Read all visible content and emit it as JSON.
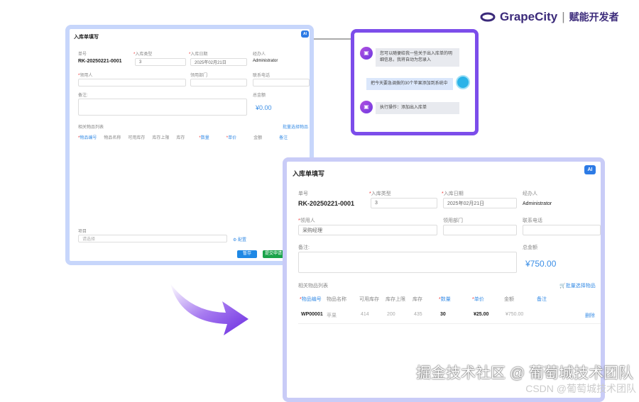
{
  "logo": {
    "brand": "GrapeCity",
    "slogan": "赋能开发者"
  },
  "form_before": {
    "title": "入库单填写",
    "ai": "AI",
    "order_no_label": "单号",
    "order_no": "RK-20250221-0001",
    "type_label": "入库类型",
    "type_value": "3",
    "date_label": "入库日期",
    "date_value": "2025年02月21日",
    "handler_label": "经办人",
    "handler": "Administrator",
    "recipient_label": "领用人",
    "dept_label": "领用部门",
    "phone_label": "联系电话",
    "remark_label": "备注:",
    "total_label": "总金额",
    "total": "¥0.00",
    "list_label": "相关物品列表",
    "batch_select": "批量选择物品",
    "columns": [
      "物品编号",
      "物品名称",
      "可用库存",
      "库存上限",
      "库存",
      "数量",
      "单价",
      "金额",
      "备注"
    ],
    "project_label": "项目",
    "project_placeholder": "请选择",
    "config": "配置",
    "save": "暂存",
    "submit": "提交申请"
  },
  "chat": {
    "messages": [
      {
        "role": "bot",
        "text": "您可以随便给我一些关于出入库单的明细信息，我将自动为您录入"
      },
      {
        "role": "user",
        "text": "把今天要急调拨的30个苹果添加到系统中"
      },
      {
        "role": "bot",
        "text": "执行操作：添加出入库单"
      }
    ]
  },
  "form_after": {
    "title": "入库单填写",
    "ai": "AI",
    "order_no_label": "单号",
    "order_no": "RK-20250221-0001",
    "type_label": "入库类型",
    "type_value": "3",
    "date_label": "入库日期",
    "date_value": "2025年02月21日",
    "handler_label": "经办人",
    "handler": "Administrator",
    "recipient_label": "领用人",
    "recipient": "采购经理",
    "dept_label": "领用部门",
    "phone_label": "联系电话",
    "remark_label": "备注:",
    "total_label": "总金额",
    "total": "¥750.00",
    "list_label": "相关物品列表",
    "batch_select": "批量选择物品",
    "columns": [
      "物品编号",
      "物品名称",
      "可用库存",
      "库存上限",
      "库存",
      "数量",
      "单价",
      "金额",
      "备注"
    ],
    "row": {
      "code": "WP00001",
      "name": "苹果",
      "available": "414",
      "max": "200",
      "stock": "435",
      "qty": "30",
      "price": "¥25.00",
      "amount": "¥750.00",
      "action": "删除"
    }
  },
  "watermark": {
    "main": "掘金技术社区 @ 葡萄城技术团队",
    "sub": "CSDN @葡萄城技术团队"
  },
  "colors": {
    "accent": "#3a8ee6",
    "purple": "#7c4dea",
    "save": "#1e88e5",
    "submit": "#1aa34a"
  }
}
